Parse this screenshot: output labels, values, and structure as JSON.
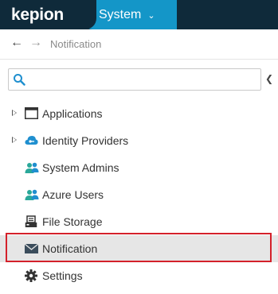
{
  "app": {
    "logo_text": "kepion",
    "section_tab": "System"
  },
  "nav": {
    "breadcrumb": "Notification"
  },
  "search": {
    "placeholder": "",
    "value": ""
  },
  "tree": [
    {
      "label": "Applications",
      "icon": "window-icon",
      "expandable": true
    },
    {
      "label": "Identity Providers",
      "icon": "cloud-key-icon",
      "expandable": true
    },
    {
      "label": "System Admins",
      "icon": "users-icon",
      "expandable": false
    },
    {
      "label": "Azure Users",
      "icon": "users-icon",
      "expandable": false
    },
    {
      "label": "File Storage",
      "icon": "server-icon",
      "expandable": false
    },
    {
      "label": "Notification",
      "icon": "envelope-icon",
      "expandable": false,
      "selected": true
    },
    {
      "label": "Settings",
      "icon": "gear-icon",
      "expandable": false
    }
  ],
  "colors": {
    "header_bg": "#0f2a3a",
    "tab_bg": "#1496c8",
    "selection_border": "#d4212b",
    "selection_bg": "#e6e6e6",
    "icon_blue": "#1f8fcf",
    "icon_teal": "#2aa89a"
  }
}
